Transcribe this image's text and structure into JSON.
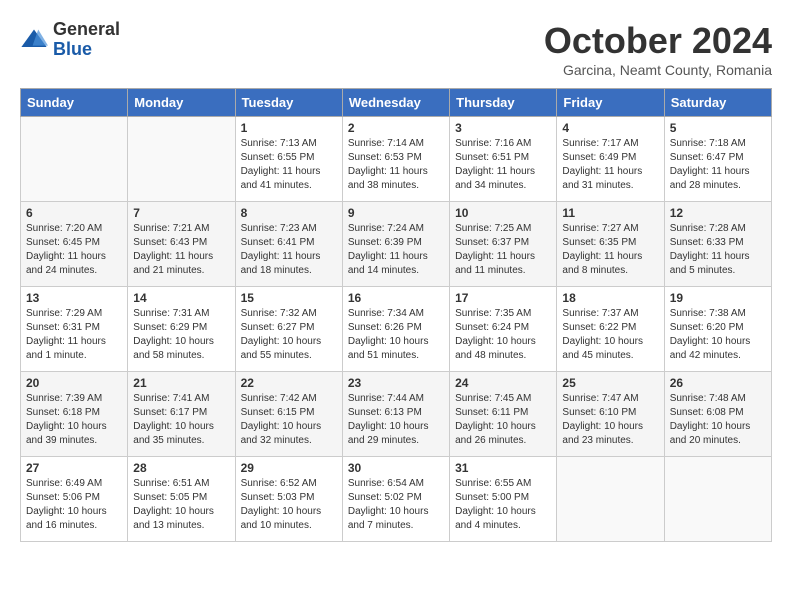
{
  "header": {
    "logo_general": "General",
    "logo_blue": "Blue",
    "month_title": "October 2024",
    "location": "Garcina, Neamt County, Romania"
  },
  "days_of_week": [
    "Sunday",
    "Monday",
    "Tuesday",
    "Wednesday",
    "Thursday",
    "Friday",
    "Saturday"
  ],
  "weeks": [
    [
      {
        "day": "",
        "content": ""
      },
      {
        "day": "",
        "content": ""
      },
      {
        "day": "1",
        "content": "Sunrise: 7:13 AM\nSunset: 6:55 PM\nDaylight: 11 hours and 41 minutes."
      },
      {
        "day": "2",
        "content": "Sunrise: 7:14 AM\nSunset: 6:53 PM\nDaylight: 11 hours and 38 minutes."
      },
      {
        "day": "3",
        "content": "Sunrise: 7:16 AM\nSunset: 6:51 PM\nDaylight: 11 hours and 34 minutes."
      },
      {
        "day": "4",
        "content": "Sunrise: 7:17 AM\nSunset: 6:49 PM\nDaylight: 11 hours and 31 minutes."
      },
      {
        "day": "5",
        "content": "Sunrise: 7:18 AM\nSunset: 6:47 PM\nDaylight: 11 hours and 28 minutes."
      }
    ],
    [
      {
        "day": "6",
        "content": "Sunrise: 7:20 AM\nSunset: 6:45 PM\nDaylight: 11 hours and 24 minutes."
      },
      {
        "day": "7",
        "content": "Sunrise: 7:21 AM\nSunset: 6:43 PM\nDaylight: 11 hours and 21 minutes."
      },
      {
        "day": "8",
        "content": "Sunrise: 7:23 AM\nSunset: 6:41 PM\nDaylight: 11 hours and 18 minutes."
      },
      {
        "day": "9",
        "content": "Sunrise: 7:24 AM\nSunset: 6:39 PM\nDaylight: 11 hours and 14 minutes."
      },
      {
        "day": "10",
        "content": "Sunrise: 7:25 AM\nSunset: 6:37 PM\nDaylight: 11 hours and 11 minutes."
      },
      {
        "day": "11",
        "content": "Sunrise: 7:27 AM\nSunset: 6:35 PM\nDaylight: 11 hours and 8 minutes."
      },
      {
        "day": "12",
        "content": "Sunrise: 7:28 AM\nSunset: 6:33 PM\nDaylight: 11 hours and 5 minutes."
      }
    ],
    [
      {
        "day": "13",
        "content": "Sunrise: 7:29 AM\nSunset: 6:31 PM\nDaylight: 11 hours and 1 minute."
      },
      {
        "day": "14",
        "content": "Sunrise: 7:31 AM\nSunset: 6:29 PM\nDaylight: 10 hours and 58 minutes."
      },
      {
        "day": "15",
        "content": "Sunrise: 7:32 AM\nSunset: 6:27 PM\nDaylight: 10 hours and 55 minutes."
      },
      {
        "day": "16",
        "content": "Sunrise: 7:34 AM\nSunset: 6:26 PM\nDaylight: 10 hours and 51 minutes."
      },
      {
        "day": "17",
        "content": "Sunrise: 7:35 AM\nSunset: 6:24 PM\nDaylight: 10 hours and 48 minutes."
      },
      {
        "day": "18",
        "content": "Sunrise: 7:37 AM\nSunset: 6:22 PM\nDaylight: 10 hours and 45 minutes."
      },
      {
        "day": "19",
        "content": "Sunrise: 7:38 AM\nSunset: 6:20 PM\nDaylight: 10 hours and 42 minutes."
      }
    ],
    [
      {
        "day": "20",
        "content": "Sunrise: 7:39 AM\nSunset: 6:18 PM\nDaylight: 10 hours and 39 minutes."
      },
      {
        "day": "21",
        "content": "Sunrise: 7:41 AM\nSunset: 6:17 PM\nDaylight: 10 hours and 35 minutes."
      },
      {
        "day": "22",
        "content": "Sunrise: 7:42 AM\nSunset: 6:15 PM\nDaylight: 10 hours and 32 minutes."
      },
      {
        "day": "23",
        "content": "Sunrise: 7:44 AM\nSunset: 6:13 PM\nDaylight: 10 hours and 29 minutes."
      },
      {
        "day": "24",
        "content": "Sunrise: 7:45 AM\nSunset: 6:11 PM\nDaylight: 10 hours and 26 minutes."
      },
      {
        "day": "25",
        "content": "Sunrise: 7:47 AM\nSunset: 6:10 PM\nDaylight: 10 hours and 23 minutes."
      },
      {
        "day": "26",
        "content": "Sunrise: 7:48 AM\nSunset: 6:08 PM\nDaylight: 10 hours and 20 minutes."
      }
    ],
    [
      {
        "day": "27",
        "content": "Sunrise: 6:49 AM\nSunset: 5:06 PM\nDaylight: 10 hours and 16 minutes."
      },
      {
        "day": "28",
        "content": "Sunrise: 6:51 AM\nSunset: 5:05 PM\nDaylight: 10 hours and 13 minutes."
      },
      {
        "day": "29",
        "content": "Sunrise: 6:52 AM\nSunset: 5:03 PM\nDaylight: 10 hours and 10 minutes."
      },
      {
        "day": "30",
        "content": "Sunrise: 6:54 AM\nSunset: 5:02 PM\nDaylight: 10 hours and 7 minutes."
      },
      {
        "day": "31",
        "content": "Sunrise: 6:55 AM\nSunset: 5:00 PM\nDaylight: 10 hours and 4 minutes."
      },
      {
        "day": "",
        "content": ""
      },
      {
        "day": "",
        "content": ""
      }
    ]
  ]
}
